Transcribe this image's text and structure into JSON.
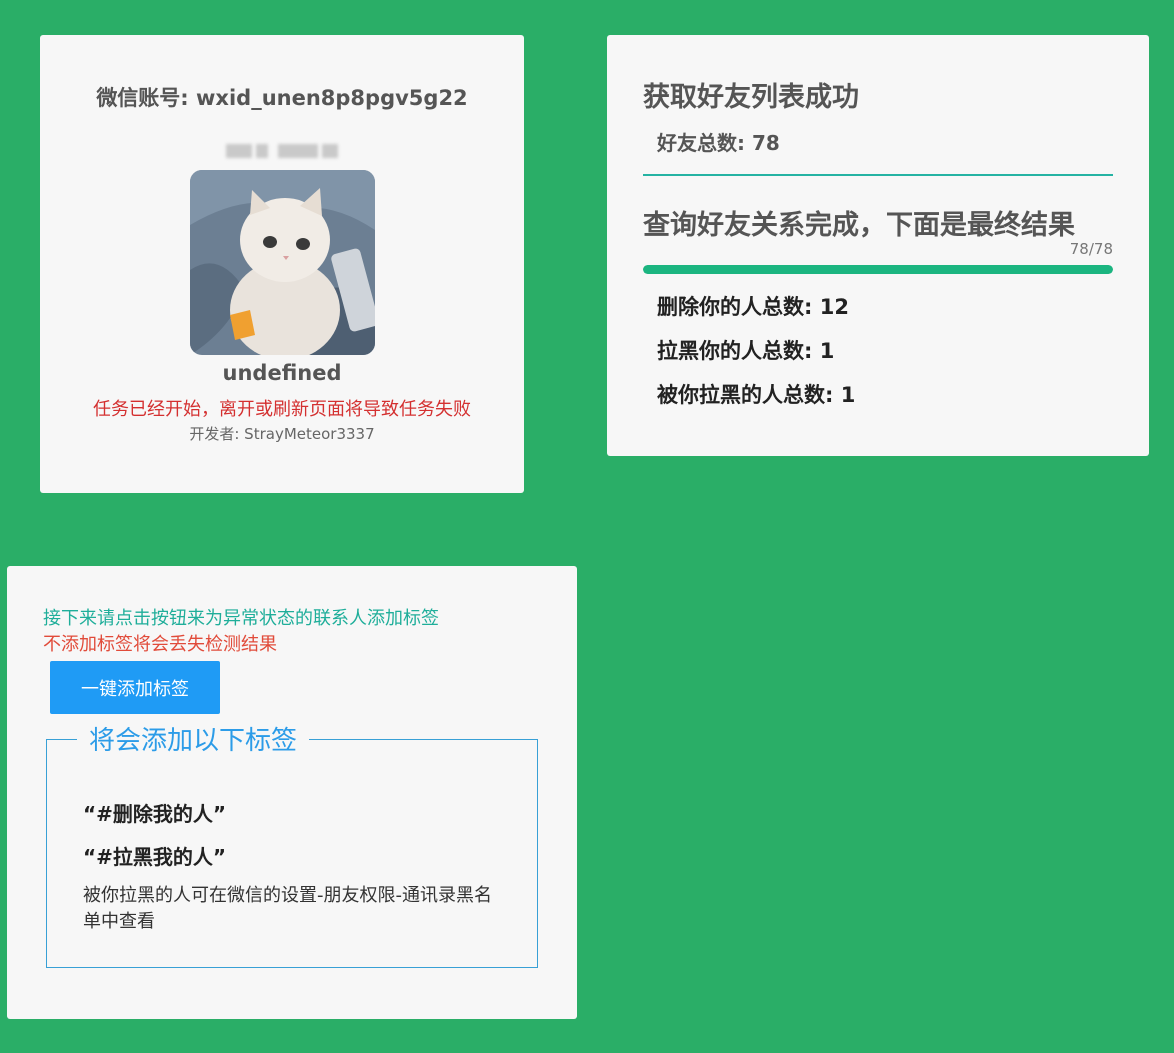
{
  "account": {
    "title": "微信账号: wxid_unen8p8pgv5g22",
    "nickname": "undefined",
    "warning": "任务已经开始，离开或刷新页面将导致任务失败",
    "developer": "开发者: StrayMeteor3337"
  },
  "result": {
    "friends_heading": "获取好友列表成功",
    "friends_total": "好友总数: 78",
    "query_heading": "查询好友关系完成，下面是最终结果",
    "progress_text": "78/78",
    "progress_fraction": 1.0,
    "stats": {
      "deleted": "删除你的人总数: 12",
      "blocked_you": "拉黑你的人总数: 1",
      "blocked_by_you": "被你拉黑的人总数: 1"
    }
  },
  "tagging": {
    "info_green": "接下来请点击按钮来为异常状态的联系人添加标签",
    "info_red": "不添加标签将会丢失检测结果",
    "button_label": "一键添加标签",
    "legend": "将会添加以下标签",
    "tags": [
      "“#删除我的人”",
      "“#拉黑我的人”"
    ],
    "note": "被你拉黑的人可在微信的设置-朋友权限-通讯录黑名单中查看"
  },
  "colors": {
    "background": "#2aae67",
    "card": "#f7f7f7",
    "progress": "#1bb580",
    "button": "#1f9bf5",
    "warning": "#d43030"
  }
}
